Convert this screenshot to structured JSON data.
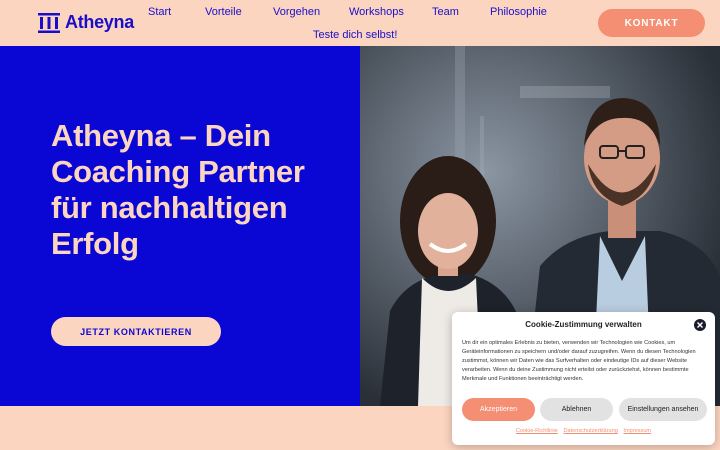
{
  "header": {
    "logo_text": "Atheyna",
    "nav": [
      {
        "label": "Start"
      },
      {
        "label": "Vorteile"
      },
      {
        "label": "Vorgehen"
      },
      {
        "label": "Workshops"
      },
      {
        "label": "Team"
      },
      {
        "label": "Philosophie"
      },
      {
        "label": "Teste dich selbst!"
      }
    ],
    "cta_label": "KONTAKT"
  },
  "hero": {
    "title": "Atheyna – Dein Coaching Partner für nachhaltigen Erfolg",
    "cta_label": "JETZT KONTAKTIEREN"
  },
  "cookie": {
    "title": "Cookie-Zustimmung verwalten",
    "text": "Um dir ein optimales Erlebnis zu bieten, verwenden wir Technologien wie Cookies, um Geräteinformationen zu speichern und/oder darauf zuzugreifen. Wenn du diesen Technologien zustimmst, können wir Daten wie das Surfverhalten oder eindeutige IDs auf dieser Website verarbeiten. Wenn du deine Zustimmung nicht erteilst oder zurückziehst, können bestimmte Merkmale und Funktionen beeinträchtigt werden.",
    "accept_label": "Akzeptieren",
    "deny_label": "Ablehnen",
    "prefs_label": "Einstellungen ansehen",
    "links": [
      {
        "label": "Cookie-Richtlinie"
      },
      {
        "label": "Datenschutzerklärung"
      },
      {
        "label": "Impressum"
      }
    ]
  },
  "colors": {
    "brand_blue": "#0a06d4",
    "peach": "#fcd5c0",
    "coral": "#f48f73"
  }
}
